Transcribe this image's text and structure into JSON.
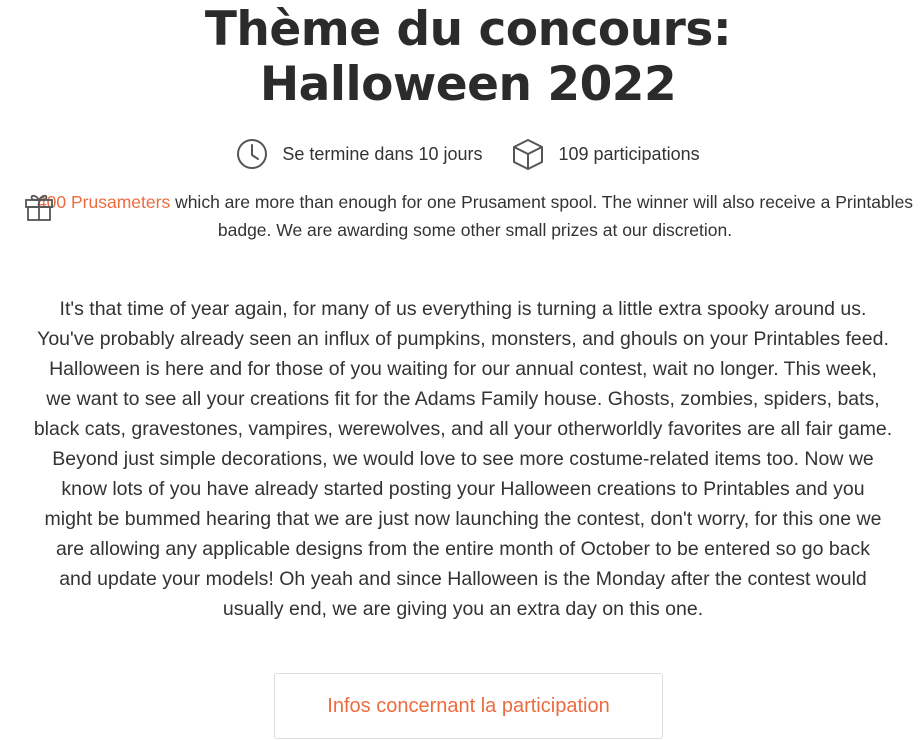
{
  "title": {
    "line1": "Thème du concours:",
    "line2": "Halloween 2022"
  },
  "stats": {
    "end_text": "Se termine dans 10 jours",
    "participations_text": "109 participations"
  },
  "prize": {
    "highlight": "400 Prusameters",
    "text": " which are more than enough for one Prusament spool. The winner will also receive a Printables badge. We are awarding some other small prizes at our discretion."
  },
  "description": {
    "lines": [
      "It's that time of year again, for many of us everything is turning a little extra spooky around us.",
      "You've probably already seen an influx of pumpkins, monsters, and ghouls on your Printables feed.",
      "Halloween is here and for those of you waiting for our annual contest, wait no longer. This week,",
      "we want to see all your creations fit for the Adams Family house. Ghosts, zombies, spiders, bats,",
      "black cats, gravestones, vampires, werewolves, and all your otherworldly favorites are all fair game.",
      "Beyond just simple decorations, we would love to see more costume-related items too. Now we",
      "know lots of you have already started posting your Halloween creations to Printables and you",
      "might be bummed hearing that we are just now launching the contest, don't worry, for this one we",
      "are allowing any applicable designs from the entire month of October to be entered so go back",
      "and update your models! Oh yeah and since Halloween is the Monday after the contest would",
      "usually end, we are giving you an extra day on this one."
    ]
  },
  "cta": {
    "label": "Infos concernant la participation"
  },
  "colors": {
    "accent": "#ed6b3f",
    "text": "#333333",
    "icon": "#555555"
  },
  "icons": {
    "clock": "clock-icon",
    "box": "box-icon",
    "gift": "gift-icon"
  }
}
